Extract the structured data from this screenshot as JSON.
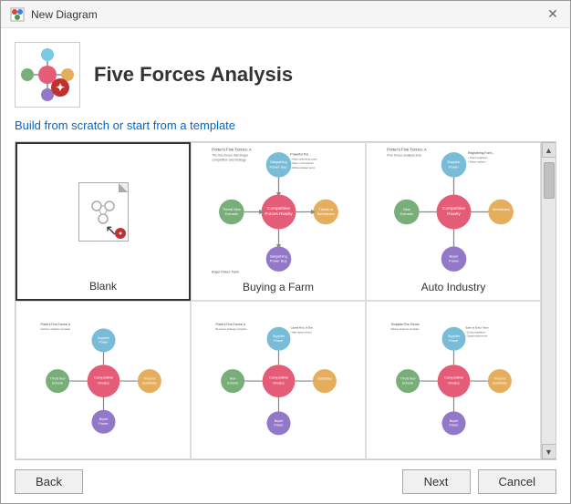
{
  "titleBar": {
    "title": "New Diagram",
    "closeLabel": "✕"
  },
  "header": {
    "diagramTitle": "Five Forces Analysis",
    "subtitle": "Build from scratch or start from a template"
  },
  "templates": [
    {
      "id": "blank",
      "label": "Blank",
      "selected": true
    },
    {
      "id": "buying-farm",
      "label": "Buying a Farm",
      "selected": false
    },
    {
      "id": "auto-industry",
      "label": "Auto Industry",
      "selected": false
    },
    {
      "id": "template4",
      "label": "",
      "selected": false
    },
    {
      "id": "template5",
      "label": "",
      "selected": false
    },
    {
      "id": "template6",
      "label": "",
      "selected": false
    }
  ],
  "buttons": {
    "back": "Back",
    "next": "Next",
    "cancel": "Cancel"
  },
  "scrollbar": {
    "upArrow": "▲",
    "downArrow": "▼"
  }
}
